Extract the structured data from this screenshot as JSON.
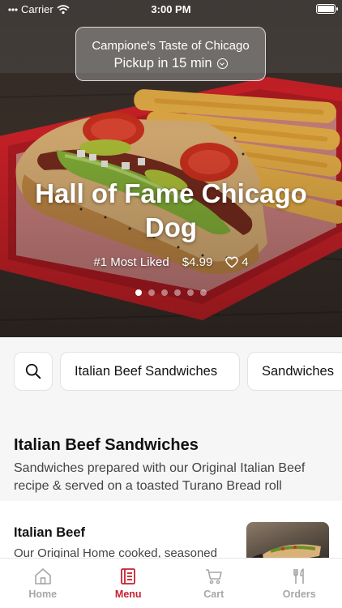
{
  "status": {
    "carrier": "Carrier",
    "time": "3:00 PM"
  },
  "store": {
    "name": "Campione's Taste of Chicago",
    "pickup": "Pickup in 15 min"
  },
  "hero": {
    "title": "Hall of Fame Chicago Dog",
    "badge": "#1 Most Liked",
    "price": "$4.99",
    "likes": "4",
    "slide_count": 6,
    "active_slide": 0
  },
  "categories": {
    "chips": [
      "Italian Beef Sandwiches",
      "Sandwiches"
    ]
  },
  "section": {
    "title": "Italian Beef Sandwiches",
    "description": "Sandwiches prepared with our Original Italian Beef recipe & served on a toasted Turano Bread roll"
  },
  "item": {
    "name": "Italian Beef",
    "description": "Our Original Home cooked, seasoned"
  },
  "tabs": [
    {
      "label": "Home",
      "icon": "home-icon",
      "active": false
    },
    {
      "label": "Menu",
      "icon": "menu-icon",
      "active": true
    },
    {
      "label": "Cart",
      "icon": "cart-icon",
      "active": false
    },
    {
      "label": "Orders",
      "icon": "fork-knife-icon",
      "active": false
    }
  ],
  "colors": {
    "accent": "#c8202f",
    "inactive_tab": "#a7a7a7",
    "background": "#f6f6f6"
  }
}
